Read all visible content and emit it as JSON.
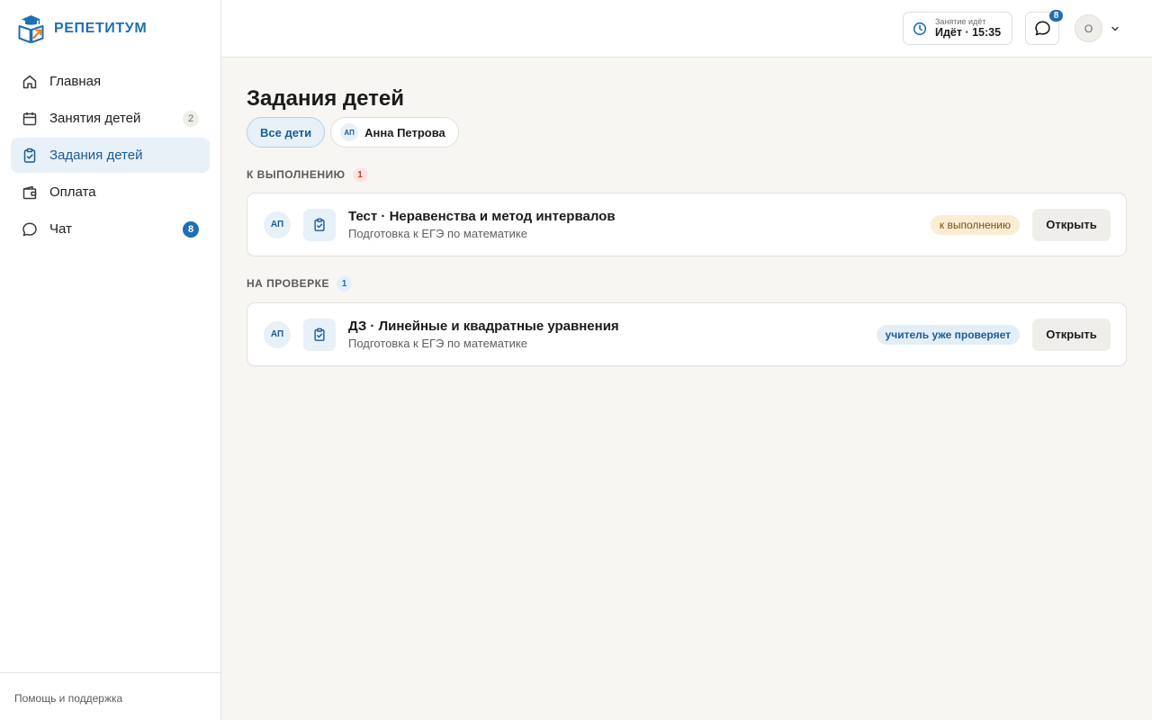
{
  "brand": {
    "name": "РЕПЕТИТУМ",
    "icon": "book-logo-icon",
    "colors": {
      "primary": "#1f6fb2",
      "accent": "#e8842a"
    }
  },
  "sidebar": {
    "items": [
      {
        "label": "Главная",
        "icon": "home-icon"
      },
      {
        "label": "Занятия детей",
        "icon": "calendar-icon",
        "count": "2"
      },
      {
        "label": "Задания детей",
        "icon": "clipboard-check-icon",
        "active": true
      },
      {
        "label": "Оплата",
        "icon": "wallet-icon"
      },
      {
        "label": "Чат",
        "icon": "chat-icon",
        "count": "8"
      }
    ],
    "footer": "Помощь и поддержка"
  },
  "topbar": {
    "session": {
      "label": "Занятие идёт",
      "value": "Идёт · 15:35"
    },
    "chat_badge": "8",
    "avatar_initial": "О"
  },
  "page": {
    "title": "Задания детей",
    "filters": [
      {
        "label": "Все дети",
        "active": true
      },
      {
        "label": "Анна Петрова",
        "initials": "АП"
      }
    ]
  },
  "sections": [
    {
      "title": "К ВЫПОЛНЕНИЮ",
      "count": "1",
      "tasks": [
        {
          "initials": "АП",
          "title": "Тест · Неравенства и метод интервалов",
          "subtitle": "Подготовка к ЕГЭ по математике",
          "status": "к выполнению",
          "action": "Открыть"
        }
      ]
    },
    {
      "title": "НА ПРОВЕРКЕ",
      "count": "1",
      "tasks": [
        {
          "initials": "АП",
          "title": "ДЗ · Линейные и квадратные уравнения",
          "subtitle": "Подготовка к ЕГЭ по математике",
          "status": "учитель уже проверяет",
          "action": "Открыть"
        }
      ]
    }
  ]
}
